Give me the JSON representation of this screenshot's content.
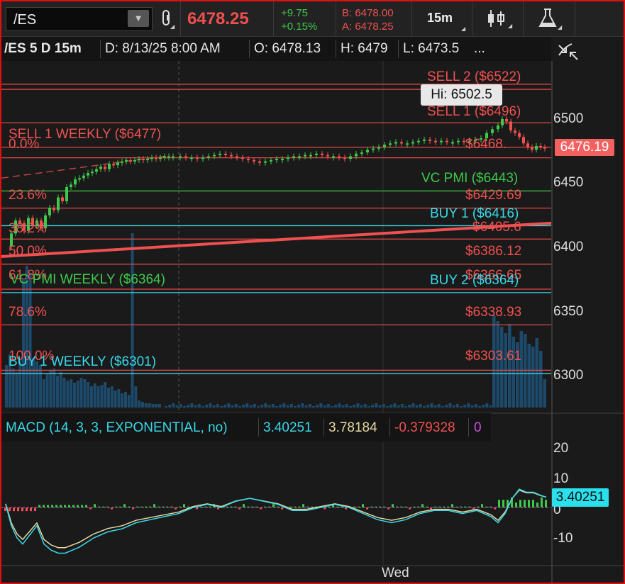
{
  "toolbar": {
    "symbol": "/ES",
    "last_price": "6478.25",
    "net_change": "+9.75",
    "percent_change": "+0.15%",
    "bid": "B: 6478.00",
    "ask": "A: 6478.25",
    "aggregation": "15m",
    "icons": [
      "chevron-down-icon",
      "link-icon",
      "candlestick-icon",
      "flask-icon"
    ]
  },
  "header": {
    "description": "/ES 5 D 15m",
    "date": "D: 8/13/25 8:00 AM",
    "open": "O: 6478.13",
    "high": "H: 6479",
    "low": "L: 6473.5",
    "more": "..."
  },
  "levels": {
    "sell2": "SELL 2 ($6522)",
    "sell1": "SELL 1 ($6496)",
    "sell1_weekly": "SELL 1 WEEKLY ($6477)",
    "fib_0": "0.0%",
    "fib_0_value": "$6468.",
    "vc_pmi": "VC PMI ($6443)",
    "fib_236": "23.6%",
    "fib_236_value": "$6429.69",
    "buy1": "BUY 1 ($6416)",
    "fib_382": "38.2%",
    "fib_382_value": "$6405.6",
    "fib_50": "50.0%",
    "fib_50_value": "$6386.12",
    "fib_618": "61.8%",
    "fib_618_value": "$6366.65",
    "vc_pmi_weekly": "VC PMI WEEKLY ($6364)",
    "buy2": "BUY 2 ($6364)",
    "fib_786": "78.6%",
    "fib_786_value": "$6338.93",
    "fib_100": "100.0%",
    "fib_100_value": "$6303.61",
    "buy1_weekly": "BUY 1 WEEKLY ($6301)"
  },
  "price_axis": {
    "ticks": [
      "6500",
      "6450",
      "6400",
      "6350",
      "6300"
    ],
    "current_price": "6476.19",
    "hi_label": "Hi: 6502.5"
  },
  "macd": {
    "title": "MACD (14, 3, 3, EXPONENTIAL, no)",
    "value": "3.40251",
    "avg": "3.78184",
    "diff": "-0.379328",
    "extra": "0",
    "ticks": [
      "20",
      "10",
      "0",
      "-10"
    ],
    "current": "3.40251"
  },
  "time_axis": {
    "label": "Wed"
  },
  "colors": {
    "up": "#3ec94a",
    "down": "#f05050",
    "level_red": "#e04848",
    "level_cyan": "#38d8e8",
    "volume": "#1d4a6a",
    "macd_value": "#38d8e8",
    "macd_avg": "#e8d8a0"
  }
}
